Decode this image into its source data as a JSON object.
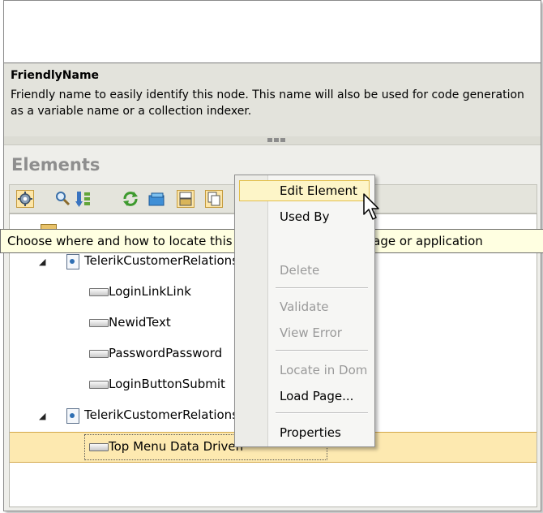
{
  "description": {
    "title": "FriendlyName",
    "text": "Friendly name to easily identify this node. This name will also be used for code generation as a variable name or a collection indexer."
  },
  "elements_panel": {
    "title": "Elements"
  },
  "toolbar": {
    "buttons": [
      "settings-icon",
      "search-icon",
      "sort-icon",
      "refresh-icon",
      "folder-icon",
      "layout-icon",
      "copy-icon"
    ]
  },
  "tooltip": {
    "text": "Choose where and how to locate this element in your web page or application"
  },
  "tree": {
    "items": [
      {
        "label": "TelerikCustomerRelations",
        "type": "page"
      },
      {
        "label": "LoginLinkLink",
        "type": "element"
      },
      {
        "label": "NewidText",
        "type": "element"
      },
      {
        "label": "PasswordPassword",
        "type": "element"
      },
      {
        "label": "LoginButtonSubmit",
        "type": "element"
      },
      {
        "label": "TelerikCustomerRelations",
        "type": "page"
      },
      {
        "label": "Top Menu Data Driven",
        "type": "element",
        "selected": true
      }
    ]
  },
  "context_menu": {
    "items": [
      {
        "label": "Edit Element",
        "enabled": true,
        "highlighted": true
      },
      {
        "label": "Used By",
        "enabled": true
      },
      {
        "label": "Delete",
        "enabled": false
      },
      {
        "label": "Validate",
        "enabled": false
      },
      {
        "label": "View Error",
        "enabled": false
      },
      {
        "label": "Locate in Dom",
        "enabled": false
      },
      {
        "label": "Load Page...",
        "enabled": true
      },
      {
        "label": "Properties",
        "enabled": true
      }
    ]
  }
}
